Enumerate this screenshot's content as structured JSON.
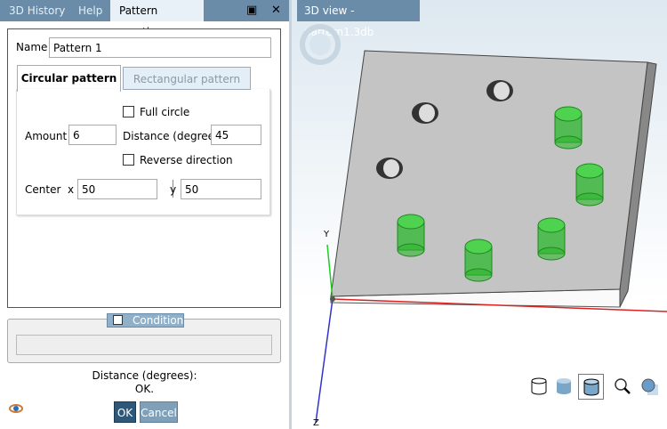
{
  "tabs": {
    "history": "3D History",
    "help": "Help",
    "pattern": "Pattern creation"
  },
  "form": {
    "name_label": "Name",
    "name_value": "Pattern 1",
    "tab_circular": "Circular pattern",
    "tab_rectangular": "Rectangular pattern",
    "full_circle": "Full circle",
    "amount_label": "Amount",
    "amount_value": "6",
    "distance_label": "Distance (degrees)",
    "distance_value": "45",
    "reverse": "Reverse direction",
    "center_label": "Center",
    "x_label": "x",
    "x_value": "50",
    "y_label": "y",
    "y_value": "50"
  },
  "condition": {
    "label": "Condition"
  },
  "status": {
    "line1": "Distance (degrees):",
    "line2": "OK."
  },
  "buttons": {
    "ok": "OK",
    "cancel": "Cancel"
  },
  "view": {
    "title": "3D view - pattern1.3db",
    "axis_y": "Y",
    "axis_z": "Z"
  },
  "colors": {
    "accent": "#6a8ca8",
    "ok_button": "#2f5878",
    "green": "#2eb82e"
  }
}
